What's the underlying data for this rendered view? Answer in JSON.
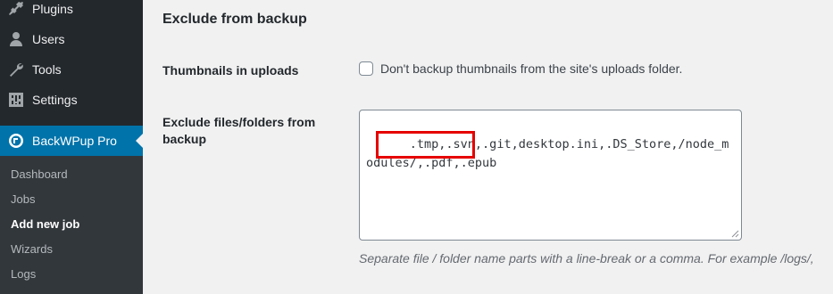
{
  "sidebar": {
    "menu": [
      {
        "label": "Plugins",
        "icon": "plug-icon"
      },
      {
        "label": "Users",
        "icon": "user-icon"
      },
      {
        "label": "Tools",
        "icon": "wrench-icon"
      },
      {
        "label": "Settings",
        "icon": "settings-icon"
      },
      {
        "label": "BackWPup Pro",
        "icon": "backwpup-logo-icon",
        "current": true
      }
    ],
    "submenu": [
      {
        "label": "Dashboard"
      },
      {
        "label": "Jobs"
      },
      {
        "label": "Add new job",
        "active": true
      },
      {
        "label": "Wizards"
      },
      {
        "label": "Logs"
      }
    ]
  },
  "main": {
    "section_title": "Exclude from backup",
    "thumbnails": {
      "label": "Thumbnails in uploads",
      "checkbox_label": "Don't backup thumbnails from the site's uploads folder.",
      "checked": false
    },
    "exclude": {
      "label": "Exclude files/folders from backup",
      "value": ".tmp,.svn,.git,desktop.ini,.DS_Store,/node_modules/,.pdf,.epub",
      "description": "Separate file / folder name parts with a line-break or a comma. For example /logs/,"
    }
  },
  "colors": {
    "sidebar_bg": "#23282d",
    "submenu_bg": "#32373c",
    "accent": "#0073aa",
    "highlight": "#e60000"
  }
}
